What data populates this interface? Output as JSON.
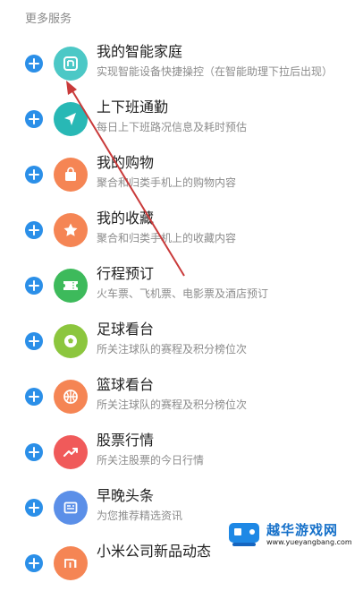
{
  "section": {
    "title": "更多服务"
  },
  "services": [
    {
      "title": "我的智能家庭",
      "subtitle": "实现智能设备快捷操控（在智能助理下拉后出现）",
      "icon": "mi-home-icon",
      "color": "#4cc8c6"
    },
    {
      "title": "上下班通勤",
      "subtitle": "每日上下班路况信息及耗时预估",
      "icon": "navigation-arrow-icon",
      "color": "#28b8b5"
    },
    {
      "title": "我的购物",
      "subtitle": "聚合和归类手机上的购物内容",
      "icon": "shopping-bag-icon",
      "color": "#f58554"
    },
    {
      "title": "我的收藏",
      "subtitle": "聚合和归类手机上的收藏内容",
      "icon": "star-icon",
      "color": "#f58554"
    },
    {
      "title": "行程预订",
      "subtitle": "火车票、飞机票、电影票及酒店预订",
      "icon": "ticket-icon",
      "color": "#3dba5b"
    },
    {
      "title": "足球看台",
      "subtitle": "所关注球队的赛程及积分榜位次",
      "icon": "soccer-ball-icon",
      "color": "#8cc63e"
    },
    {
      "title": "篮球看台",
      "subtitle": "所关注球队的赛程及积分榜位次",
      "icon": "basketball-icon",
      "color": "#f58554"
    },
    {
      "title": "股票行情",
      "subtitle": "所关注股票的今日行情",
      "icon": "stock-trend-icon",
      "color": "#f05a5a"
    },
    {
      "title": "早晚头条",
      "subtitle": "为您推荐精选资讯",
      "icon": "news-icon",
      "color": "#5b8fe8"
    },
    {
      "title": "小米公司新品动态",
      "subtitle": "",
      "icon": "mi-logo-icon",
      "color": "#f58554"
    }
  ],
  "watermark": {
    "text": "越华游戏网",
    "url": "www.yueyangbang.com"
  }
}
